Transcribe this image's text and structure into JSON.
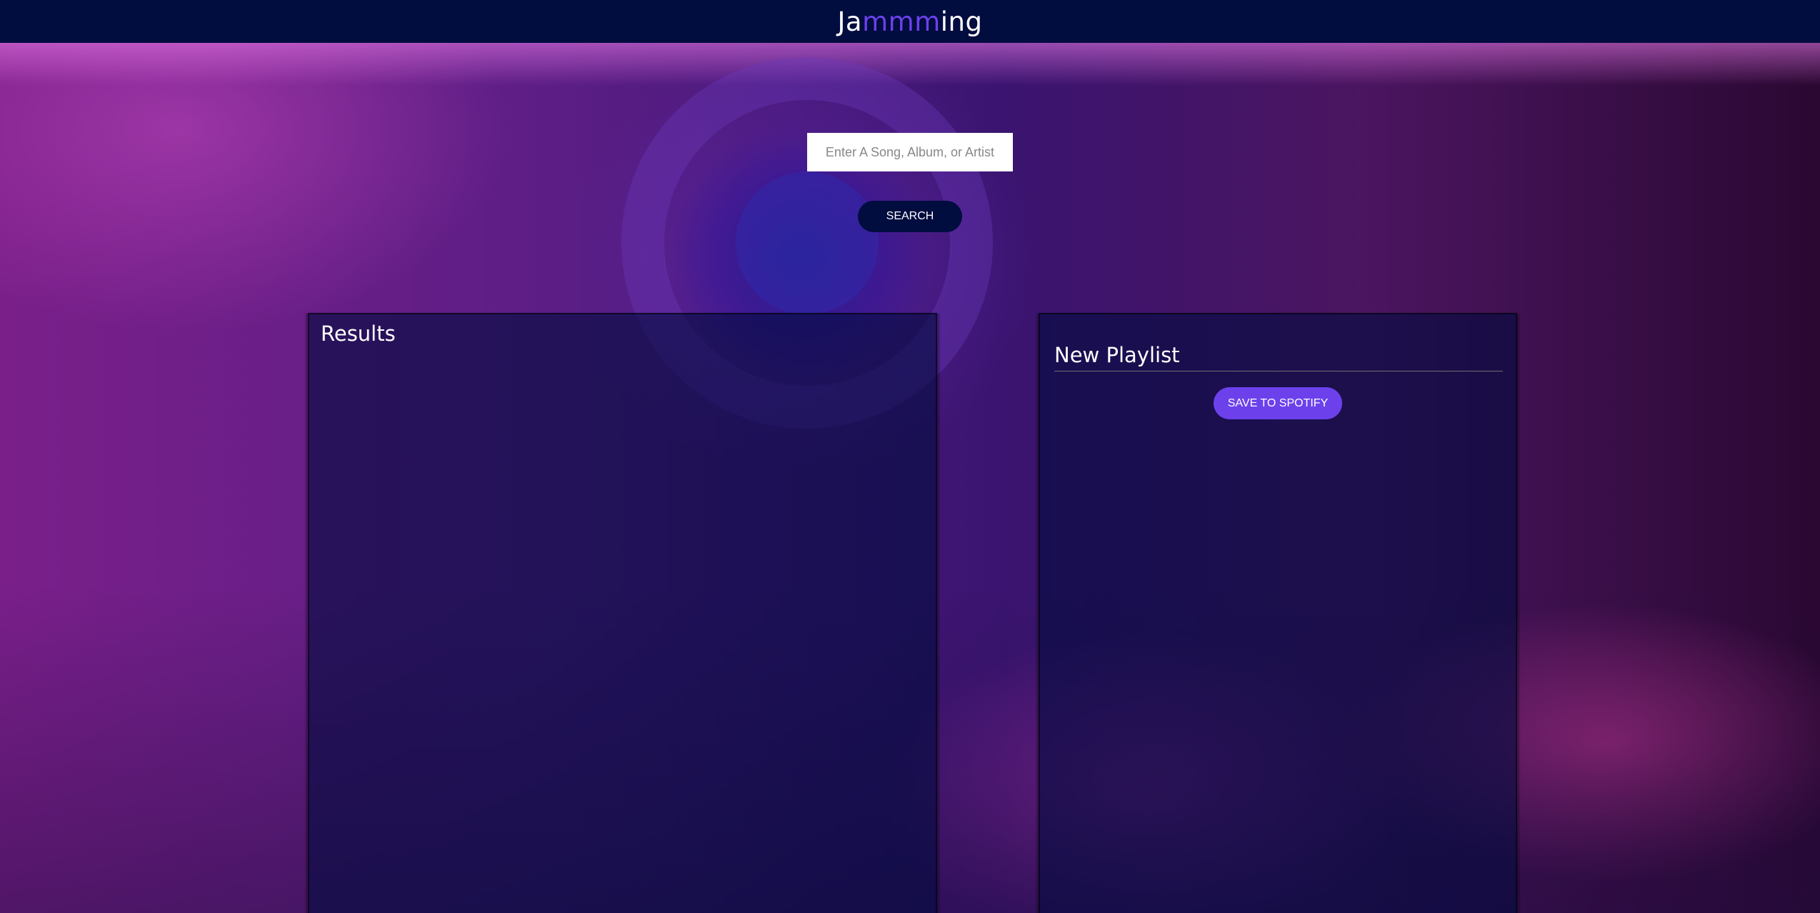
{
  "header": {
    "logo_prefix": "Ja",
    "logo_accent": "mmm",
    "logo_suffix": "ing"
  },
  "search": {
    "placeholder": "Enter A Song, Album, or Artist",
    "value": "",
    "button_label": "SEARCH"
  },
  "results": {
    "title": "Results",
    "tracks": []
  },
  "playlist": {
    "name": "New Playlist",
    "save_label": "SAVE TO SPOTIFY",
    "tracks": []
  },
  "colors": {
    "header_bg": "#010c3f",
    "accent": "#6c41ec",
    "panel_bg": "rgba(1,12,63,0.62)"
  }
}
